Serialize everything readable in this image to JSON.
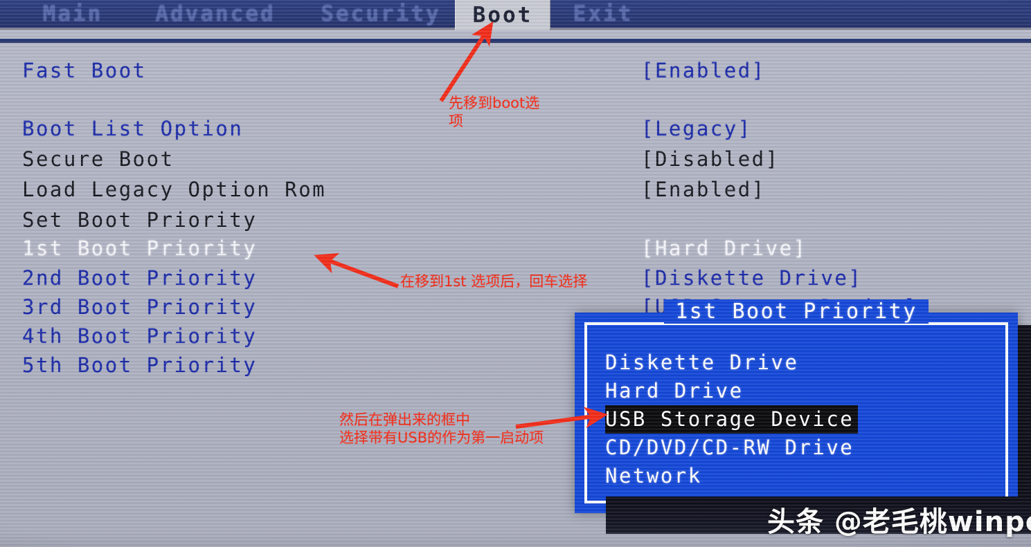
{
  "screen": {
    "background_color": "#b0b3c3",
    "menubar_color": "#283877",
    "popup_color": "#1246d8",
    "annotation_color": "#f22b18"
  },
  "menubar": {
    "tabs": [
      {
        "label": "Main",
        "active": false
      },
      {
        "label": "Advanced",
        "active": false
      },
      {
        "label": "Security",
        "active": false
      },
      {
        "label": "Boot",
        "active": true
      },
      {
        "label": "Exit",
        "active": false
      }
    ]
  },
  "settings": [
    {
      "label": "Fast Boot",
      "value": "[Enabled]",
      "label_style": "blue",
      "value_style": "blue"
    },
    {
      "label": "Boot List Option",
      "value": "[Legacy]",
      "label_style": "blue",
      "value_style": "blue"
    },
    {
      "label": "Secure Boot",
      "value": "[Disabled]",
      "label_style": "dark",
      "value_style": "dark"
    },
    {
      "label": "Load Legacy Option Rom",
      "value": "[Enabled]",
      "label_style": "dark",
      "value_style": "dark"
    },
    {
      "label": "Set Boot Priority",
      "value": "",
      "label_style": "dark",
      "value_style": "dark"
    },
    {
      "label": "1st Boot Priority",
      "value": "[Hard Drive]",
      "label_style": "white",
      "value_style": "white"
    },
    {
      "label": "2nd Boot Priority",
      "value": "[Diskette Drive]",
      "label_style": "blue",
      "value_style": "blue"
    },
    {
      "label": "3rd Boot Priority",
      "value": "[USB Storage Device]",
      "label_style": "blue",
      "value_style": "blue"
    },
    {
      "label": "4th Boot Priority",
      "value": "",
      "label_style": "blue",
      "value_style": "blue"
    },
    {
      "label": "5th Boot Priority",
      "value": "",
      "label_style": "blue",
      "value_style": "blue"
    }
  ],
  "popup": {
    "title": "1st Boot Priority",
    "options": [
      {
        "label": "Diskette Drive",
        "selected": false
      },
      {
        "label": "Hard Drive",
        "selected": false
      },
      {
        "label": "USB Storage Device",
        "selected": true
      },
      {
        "label": "CD/DVD/CD-RW Drive",
        "selected": false
      },
      {
        "label": "Network",
        "selected": false
      }
    ]
  },
  "annotations": [
    {
      "id": "annot-1",
      "text": "先移到boot选\n项"
    },
    {
      "id": "annot-2",
      "text": "在移到1st 选项后，回车选择"
    },
    {
      "id": "annot-3",
      "text": "然后在弹出来的框中\n选择带有USB的作为第一启动项"
    }
  ],
  "watermark": {
    "text": "头条 @老毛桃winpe"
  }
}
